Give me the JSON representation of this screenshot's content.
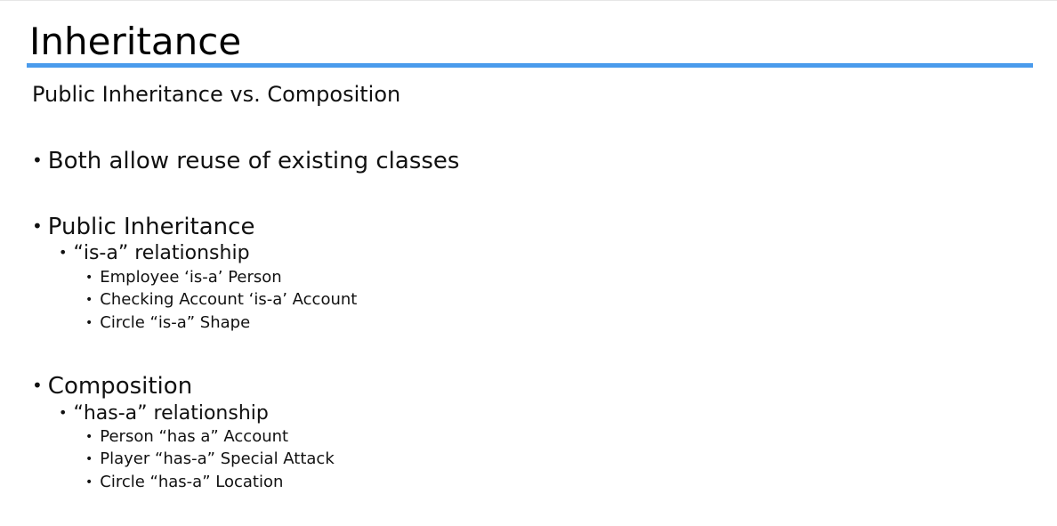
{
  "slide": {
    "title": "Inheritance",
    "subtitle": "Public Inheritance vs. Composition",
    "bullet_glyph": "•",
    "points": [
      {
        "text": "Both allow reuse of existing classes"
      },
      {
        "text": "Public Inheritance",
        "sub": {
          "text": "“is-a” relationship",
          "examples": [
            "Employee ‘is-a’ Person",
            "Checking Account ‘is-a’ Account",
            "Circle “is-a” Shape"
          ]
        }
      },
      {
        "text": "Composition",
        "sub": {
          "text": "“has-a” relationship",
          "examples": [
            "Person “has a” Account",
            "Player “has-a” Special Attack",
            "Circle “has-a” Location"
          ]
        }
      }
    ]
  },
  "colors": {
    "title_rule": "#4a9bec",
    "text": "#111111",
    "background": "#ffffff"
  }
}
